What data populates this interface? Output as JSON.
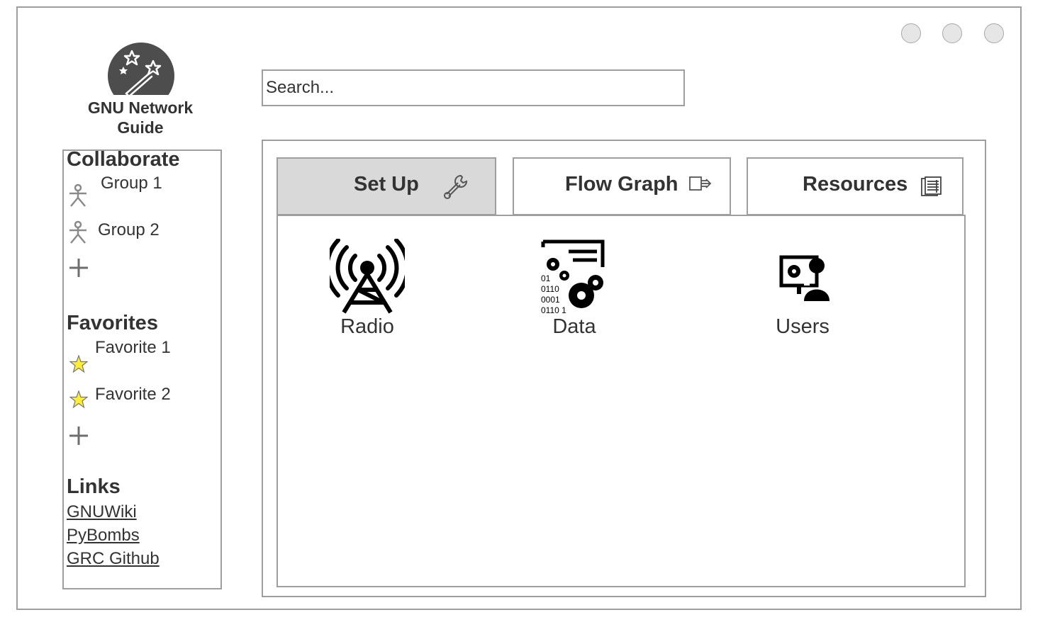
{
  "app": {
    "title": "GNU Network Guide"
  },
  "search": {
    "placeholder": "Search..."
  },
  "sidebar": {
    "collaborate": {
      "heading": "Collaborate",
      "groups": [
        {
          "label": "Group 1",
          "icon": "person-icon"
        },
        {
          "label": "Group 2",
          "icon": "person-icon"
        }
      ],
      "add_icon": "plus-icon"
    },
    "favorites": {
      "heading": "Favorites",
      "items": [
        {
          "label": "Favorite 1",
          "icon": "star-icon"
        },
        {
          "label": "Favorite 2",
          "icon": "star-icon"
        }
      ],
      "add_icon": "plus-icon"
    },
    "links": {
      "heading": "Links",
      "items": [
        {
          "label": "GNUWiki"
        },
        {
          "label": "PyBombs"
        },
        {
          "label": "GRC Github"
        }
      ]
    }
  },
  "tabs": [
    {
      "label": "Set Up",
      "icon": "wrench-icon",
      "active": true
    },
    {
      "label": "Flow Graph",
      "icon": "export-icon",
      "active": false
    },
    {
      "label": "Resources",
      "icon": "document-icon",
      "active": false
    }
  ],
  "tiles": [
    {
      "label": "Radio",
      "icon": "radio-tower-icon"
    },
    {
      "label": "Data",
      "icon": "data-gears-icon"
    },
    {
      "label": "Users",
      "icon": "user-computer-icon"
    }
  ],
  "window_controls": [
    {
      "name": "window-button"
    },
    {
      "name": "window-button"
    },
    {
      "name": "window-button"
    }
  ],
  "colors": {
    "border": "#9e9e9e",
    "active_tab": "#d9d9d9",
    "text": "#333333",
    "logo_bg": "#4d4d4d",
    "star": "#ffee33"
  }
}
